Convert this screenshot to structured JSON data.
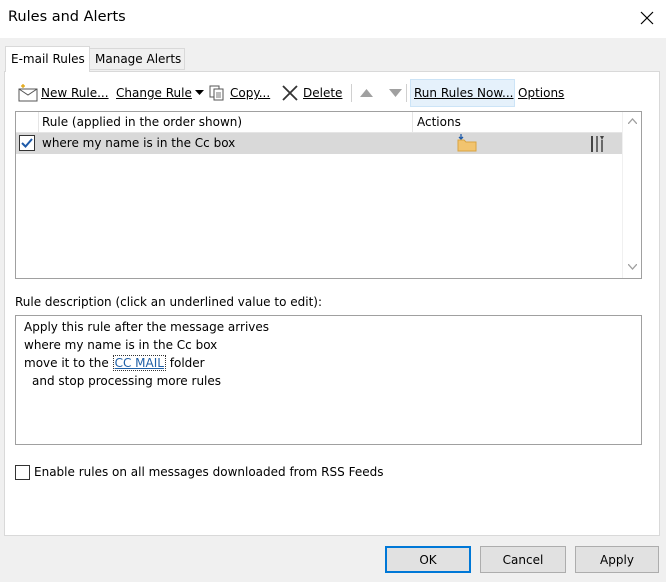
{
  "window": {
    "title": "Rules and Alerts"
  },
  "tabs": [
    {
      "label": "E-mail Rules",
      "active": true
    },
    {
      "label": "Manage Alerts",
      "active": false
    }
  ],
  "toolbar": {
    "new_rule": "New Rule...",
    "change_rule": "Change Rule",
    "copy": "Copy...",
    "delete": "Delete",
    "run_rules_now": "Run Rules Now...",
    "options": "Options"
  },
  "rules_list": {
    "columns": [
      "Rule (applied in the order shown)",
      "Actions"
    ],
    "rows": [
      {
        "name": "where my name is in the Cc box",
        "checked": true
      }
    ]
  },
  "description": {
    "label": "Rule description (click an underlined value to edit):",
    "line1": "Apply this rule after the message arrives",
    "line2": "where my name is in the Cc box",
    "line3_prefix": "move it to the",
    "line3_link": "CC MAIL",
    "line3_suffix": "folder",
    "line4": "and stop processing more rules"
  },
  "rss": {
    "label": "Enable rules on all messages downloaded from RSS Feeds",
    "checked": false
  },
  "buttons": {
    "ok": "OK",
    "cancel": "Cancel",
    "apply": "Apply"
  },
  "colors": {
    "accent": "#0078d7",
    "link": "#1f5fa6",
    "row_selected": "#d9d9d9"
  }
}
